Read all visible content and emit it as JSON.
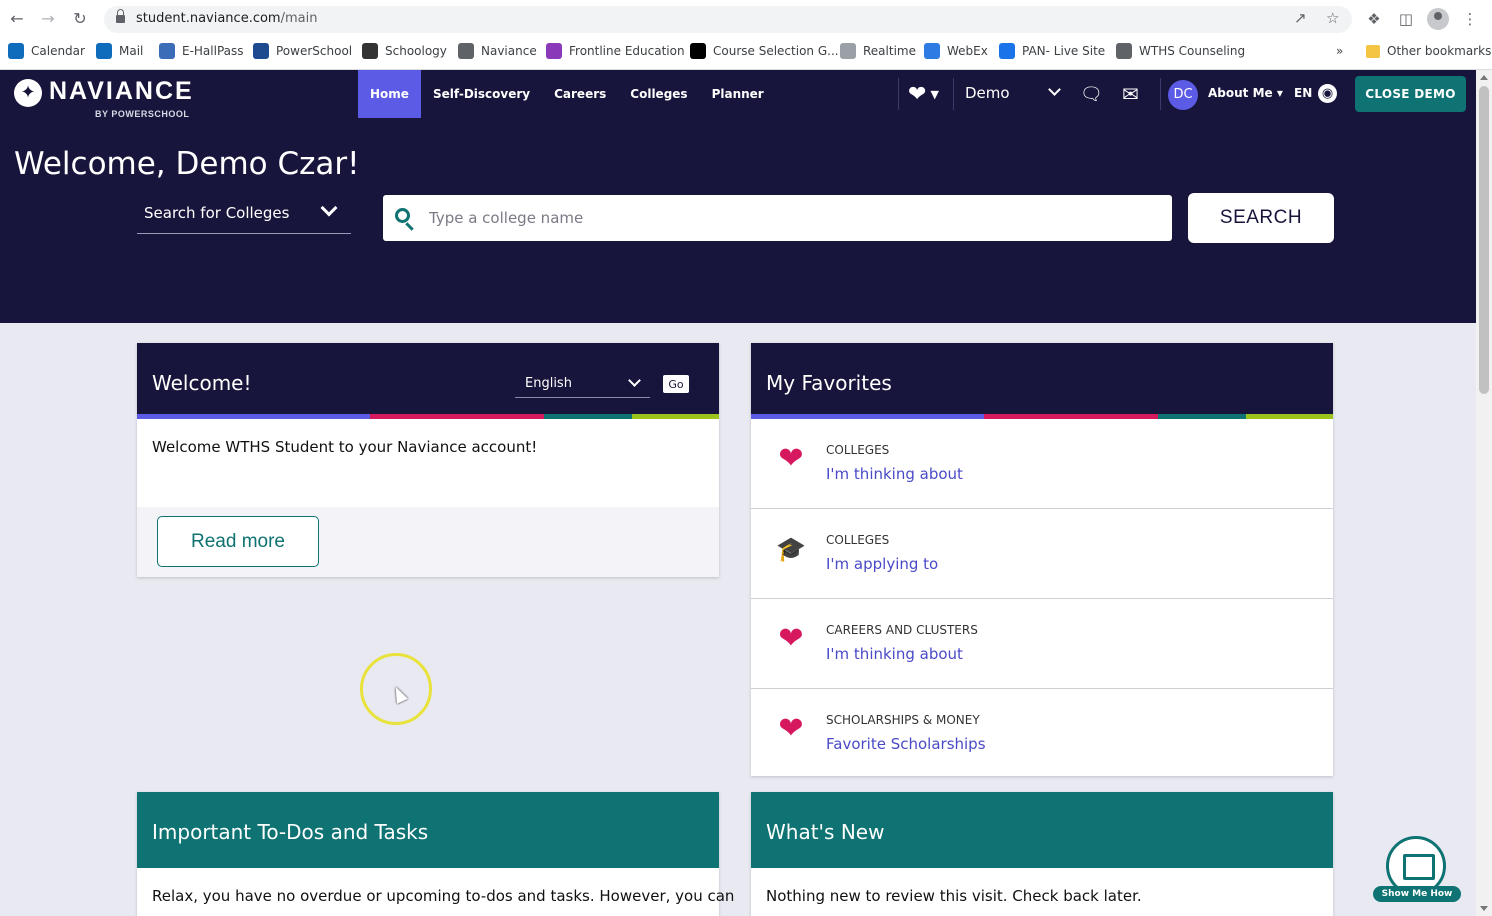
{
  "browser": {
    "url_host": "student.naviance.com",
    "url_path": "/main",
    "bookmarks": [
      {
        "label": "Calendar",
        "icon": "outlook-calendar-icon",
        "color": "#0f6cbd"
      },
      {
        "label": "Mail",
        "icon": "outlook-mail-icon",
        "color": "#0f6cbd"
      },
      {
        "label": "E-HallPass",
        "icon": "hallpass-icon",
        "color": "#3b6cb7"
      },
      {
        "label": "PowerSchool",
        "icon": "sis-icon",
        "color": "#1e4b8f"
      },
      {
        "label": "Schoology",
        "icon": "schoology-icon",
        "color": "#333333"
      },
      {
        "label": "Naviance",
        "icon": "globe-icon",
        "color": "#5f6368"
      },
      {
        "label": "Frontline Education",
        "icon": "frontline-icon",
        "color": "#8a3ab9"
      },
      {
        "label": "Course Selection G...",
        "icon": "blackboard-icon",
        "color": "#000000"
      },
      {
        "label": "Realtime",
        "icon": "realtime-icon",
        "color": "#9aa0a6"
      },
      {
        "label": "WebEx",
        "icon": "webex-icon",
        "color": "#2d7be3"
      },
      {
        "label": "PAN- Live Site",
        "icon": "pan-icon",
        "color": "#1a73e8"
      },
      {
        "label": "WTHS Counseling",
        "icon": "globe-icon",
        "color": "#5f6368"
      }
    ],
    "more_bookmarks": "»",
    "other_bookmarks": "Other bookmarks"
  },
  "header": {
    "logo_text": "NAVIANCE",
    "logo_sub": "BY POWERSCHOOL",
    "nav": [
      {
        "label": "Home",
        "active": true
      },
      {
        "label": "Self-Discovery",
        "active": false
      },
      {
        "label": "Careers",
        "active": false
      },
      {
        "label": "Colleges",
        "active": false
      },
      {
        "label": "Planner",
        "active": false
      }
    ],
    "demo_select": "Demo",
    "avatar_initials": "DC",
    "about_me": "About Me ▾",
    "language": "EN",
    "close_demo": "CLOSE DEMO"
  },
  "hero": {
    "welcome": "Welcome, Demo Czar!",
    "search_type": "Search for Colleges",
    "search_placeholder": "Type a college name",
    "search_button": "SEARCH"
  },
  "welcome_card": {
    "title": "Welcome!",
    "language": "English",
    "go": "Go",
    "message": "Welcome WTHS Student to your Naviance account!",
    "read_more": "Read more"
  },
  "favorites": {
    "title": "My Favorites",
    "items": [
      {
        "category": "COLLEGES",
        "link": "I'm thinking about",
        "icon": "heart-icon"
      },
      {
        "category": "COLLEGES",
        "link": "I'm applying to",
        "icon": "graduation-cap-icon"
      },
      {
        "category": "CAREERS AND CLUSTERS",
        "link": "I'm thinking about",
        "icon": "heart-icon"
      },
      {
        "category": "SCHOLARSHIPS & MONEY",
        "link": "Favorite Scholarships",
        "icon": "heart-icon"
      }
    ]
  },
  "todos": {
    "title": "Important To-Dos and Tasks",
    "message": "Relax, you have no overdue or upcoming to-dos and tasks. However, you can"
  },
  "whats_new": {
    "title": "What's New",
    "message": "Nothing new to review this visit. Check back later."
  },
  "help_widget": {
    "label": "Show Me How"
  },
  "colors": {
    "header_bg": "#17153b",
    "accent_active": "#5b5be6",
    "teal": "#0e7372",
    "heart": "#d6185f",
    "link": "#4a4ac8",
    "stripe": [
      "#5b5be6",
      "#d6185f",
      "#0e7372",
      "#9bc31c"
    ]
  }
}
